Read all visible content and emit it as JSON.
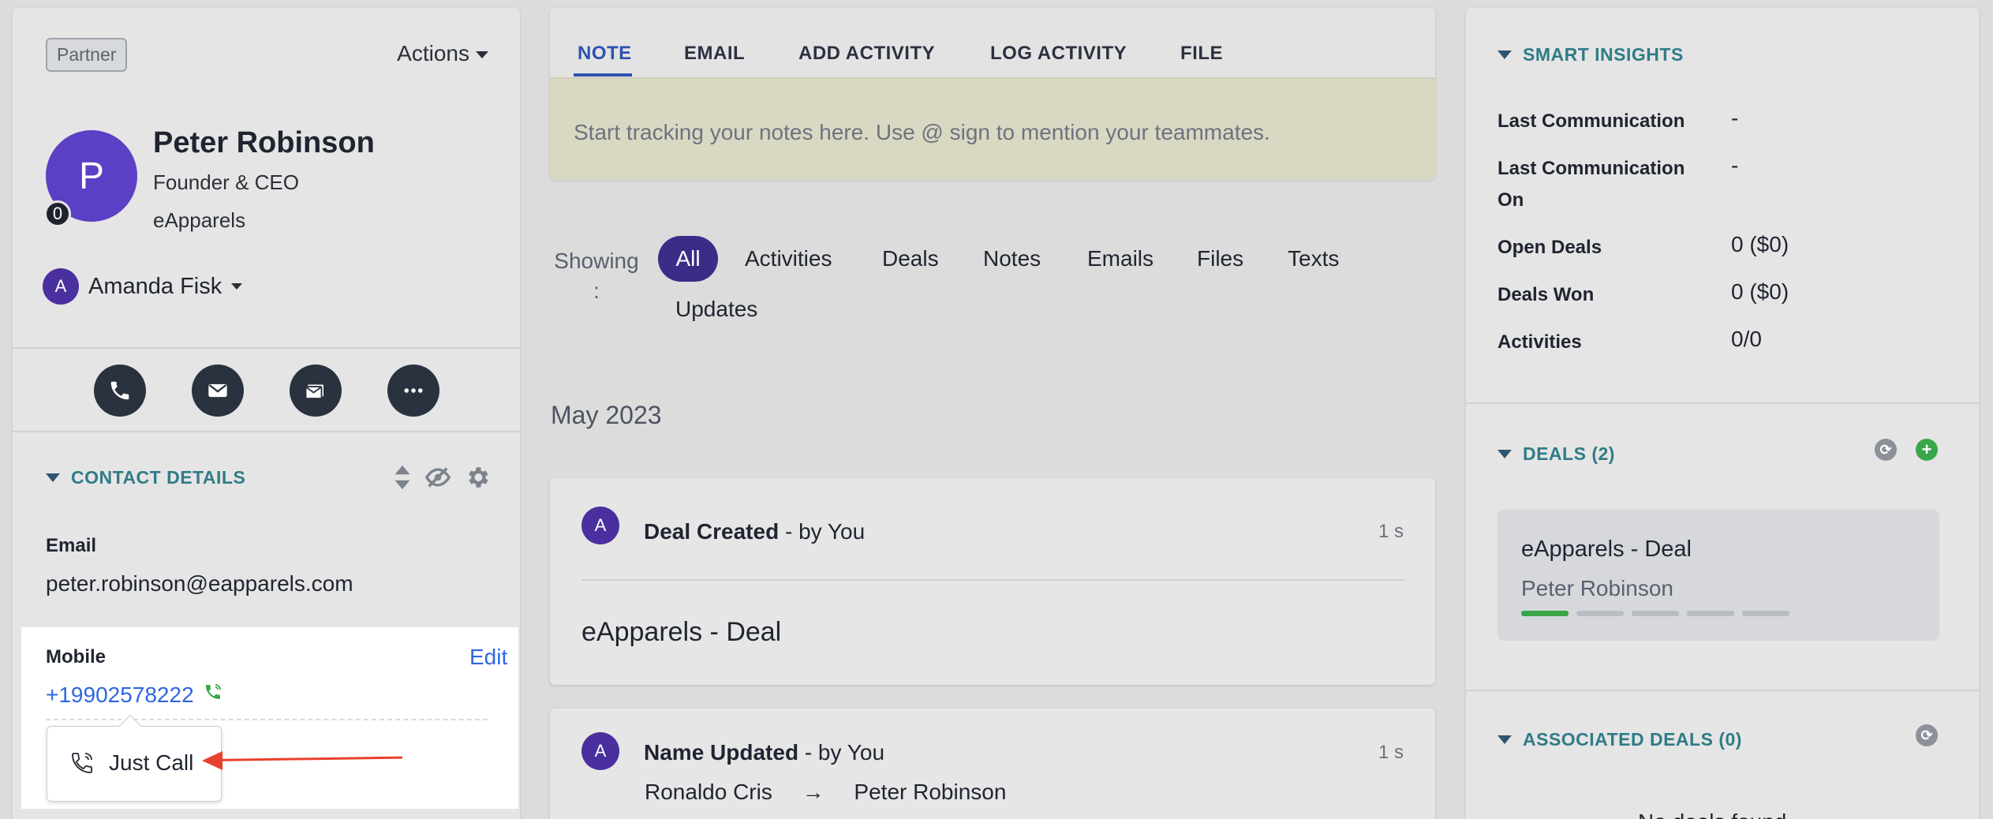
{
  "left": {
    "badge": "Partner",
    "actions_label": "Actions",
    "avatar_letter": "P",
    "avatar_count": "0",
    "name": "Peter Robinson",
    "title": "Founder & CEO",
    "company": "eApparels",
    "owner_letter": "A",
    "owner_name": "Amanda Fisk",
    "contact_details_heading": "CONTACT DETAILS",
    "email_label": "Email",
    "email_value": "peter.robinson@eapparels.com",
    "mobile_label": "Mobile",
    "edit_label": "Edit",
    "mobile_value": "+19902578222",
    "popup_item": "Just Call"
  },
  "tabs": {
    "items": [
      "NOTE",
      "EMAIL",
      "ADD ACTIVITY",
      "LOG ACTIVITY",
      "FILE"
    ],
    "note_placeholder": "Start tracking your notes here. Use @ sign to mention your teammates."
  },
  "filters": {
    "showing_label": "Showing",
    "showing_colon": ":",
    "active": "All",
    "items": [
      "Activities",
      "Deals",
      "Notes",
      "Emails",
      "Files",
      "Texts",
      "Updates"
    ]
  },
  "timeline": {
    "month": "May 2023",
    "cards": [
      {
        "avatar": "A",
        "title": "Deal Created",
        "by": " - by You",
        "time": "1 s",
        "body": "eApparels - Deal"
      },
      {
        "avatar": "A",
        "title": "Name Updated",
        "by": " - by You",
        "time": "1 s",
        "from": "Ronaldo Cris",
        "arrow": "→",
        "to": "Peter Robinson"
      }
    ]
  },
  "right": {
    "smart_insights_heading": "SMART INSIGHTS",
    "insights": [
      {
        "label": "Last Communication",
        "value": "-"
      },
      {
        "label": "Last Communication On",
        "value": "-"
      },
      {
        "label": "Open Deals",
        "value": "0 ($0)"
      },
      {
        "label": "Deals Won",
        "value": "0 ($0)"
      },
      {
        "label": "Activities",
        "value": "0/0"
      }
    ],
    "deals_heading": "DEALS (2)",
    "deal_title": "eApparels - Deal",
    "deal_contact": "Peter Robinson",
    "deal_stage_progress": 0.2,
    "associated_heading": "ASSOCIATED DEALS (0)",
    "no_deals": "No deals found"
  },
  "colors": {
    "accent_blue": "#2c52b0",
    "teal_heading": "#2f7c87",
    "avatar_purple": "#5b3fc4",
    "link_blue": "#2e66e0",
    "annotation_red": "#e8412c",
    "stage_green": "#3aa64a"
  },
  "icons": [
    "caret-down-icon",
    "phone-icon",
    "mail-icon",
    "sms-icon",
    "more-icon",
    "sort-icon",
    "eye-off-icon",
    "gear-icon",
    "call-icon",
    "refresh-icon",
    "add-icon"
  ]
}
